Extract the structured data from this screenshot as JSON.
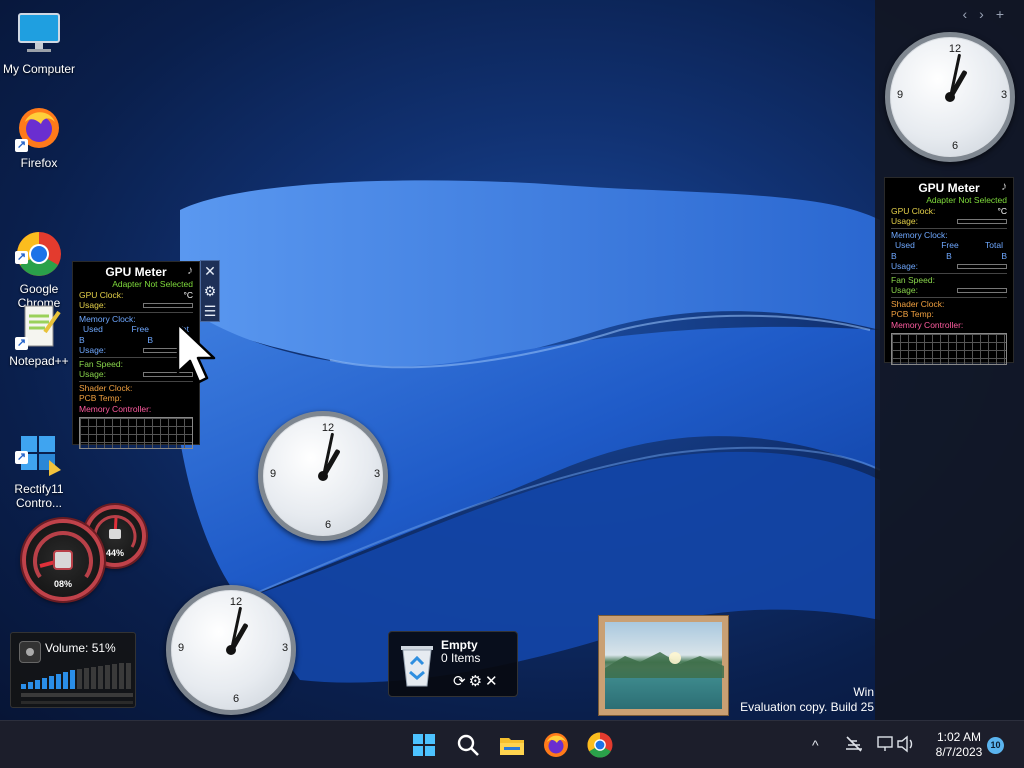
{
  "desktop_icons": [
    {
      "label": "My Computer",
      "icon": "monitor-icon",
      "shortcut": false
    },
    {
      "label": "Firefox",
      "icon": "firefox-icon",
      "shortcut": true
    },
    {
      "label": "Google\nChrome",
      "icon": "chrome-icon",
      "shortcut": true
    },
    {
      "label": "Notepad++",
      "icon": "notepad-plus-plus-icon",
      "shortcut": true
    },
    {
      "label": "Rectify11\nContro...",
      "icon": "rectify11-control-panel-icon",
      "shortcut": true
    }
  ],
  "sidebar": {
    "nav": [
      "‹",
      "›",
      "+"
    ]
  },
  "clocks": {
    "numerals": [
      "12",
      "3",
      "6",
      "9"
    ],
    "hour_hand_angle_deg": 30,
    "minute_hand_angle_deg": 12
  },
  "gpu_meter": {
    "title": "GPU Meter",
    "adapter": "Adapter Not Selected",
    "gpu_clock": "GPU Clock:",
    "temp_unit": "°C",
    "usage": "Usage:",
    "memory_clock": "Memory Clock:",
    "used": "Used",
    "free": "Free",
    "total": "Total",
    "b": "B",
    "fan_speed": "Fan Speed:",
    "shader_clock": "Shader Clock:",
    "pcb_temp": "PCB Temp:",
    "memory_controller": "Memory Controller:",
    "total_partial": "Tot"
  },
  "gadget_tools": {
    "close": "✕",
    "options": "⚙",
    "drag": "☰"
  },
  "speedometer": {
    "cpu_value": "08%",
    "mem_value": "44%"
  },
  "volume": {
    "label": "Volume: 51%",
    "level_percent": 51
  },
  "recycle_bin": {
    "status": "Empty",
    "items": "0 Items",
    "actions": "⟳⚙✕"
  },
  "watermark": {
    "line1": "Win",
    "line2": "Evaluation copy. Build 25"
  },
  "taskbar": {
    "apps": [
      "start-icon",
      "search-icon",
      "file-explorer-icon",
      "firefox-icon",
      "chrome-icon"
    ],
    "tray": {
      "chevron": "^",
      "time": "1:02 AM",
      "date": "8/7/2023",
      "notifications": "10"
    }
  },
  "colors": {
    "accent": "#2a8ee8",
    "taskbar": "#1c1e2b",
    "gpu_green": "#7fdb3c"
  }
}
